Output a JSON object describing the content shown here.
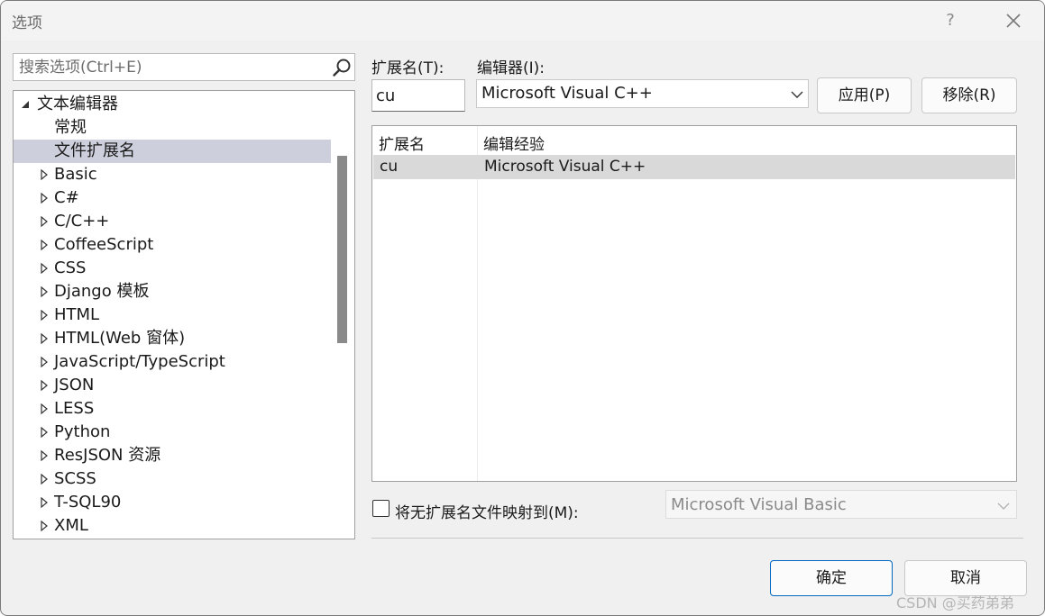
{
  "window": {
    "title": "选项",
    "help_label": "?"
  },
  "search": {
    "placeholder": "搜索选项(Ctrl+E)"
  },
  "tree": {
    "items": [
      {
        "label": "文本编辑器",
        "level": 0,
        "expanded": true,
        "selected": false
      },
      {
        "label": "常规",
        "level": 1,
        "selected": false
      },
      {
        "label": "文件扩展名",
        "level": 1,
        "selected": true
      },
      {
        "label": "Basic",
        "level": 1,
        "collapsed": true
      },
      {
        "label": "C#",
        "level": 1,
        "collapsed": true
      },
      {
        "label": "C/C++",
        "level": 1,
        "collapsed": true
      },
      {
        "label": "CoffeeScript",
        "level": 1,
        "collapsed": true
      },
      {
        "label": "CSS",
        "level": 1,
        "collapsed": true
      },
      {
        "label": "Django 模板",
        "level": 1,
        "collapsed": true
      },
      {
        "label": "HTML",
        "level": 1,
        "collapsed": true
      },
      {
        "label": "HTML(Web 窗体)",
        "level": 1,
        "collapsed": true
      },
      {
        "label": "JavaScript/TypeScript",
        "level": 1,
        "collapsed": true
      },
      {
        "label": "JSON",
        "level": 1,
        "collapsed": true
      },
      {
        "label": "LESS",
        "level": 1,
        "collapsed": true
      },
      {
        "label": "Python",
        "level": 1,
        "collapsed": true
      },
      {
        "label": "ResJSON 资源",
        "level": 1,
        "collapsed": true
      },
      {
        "label": "SCSS",
        "level": 1,
        "collapsed": true
      },
      {
        "label": "T-SQL90",
        "level": 1,
        "collapsed": true
      },
      {
        "label": "XML",
        "level": 1,
        "collapsed": true
      }
    ]
  },
  "extension": {
    "label": "扩展名(T):",
    "value": "cu"
  },
  "editor": {
    "label": "编辑器(I):",
    "value": "Microsoft Visual C++"
  },
  "buttons": {
    "apply": "应用(P)",
    "remove": "移除(R)",
    "ok": "确定",
    "cancel": "取消"
  },
  "mapping_list": {
    "columns": [
      "扩展名",
      "编辑经验"
    ],
    "rows": [
      {
        "extension": "cu",
        "editor": "Microsoft Visual C++"
      }
    ]
  },
  "map_extensionless": {
    "label": "将无扩展名文件映射到(M):",
    "checked": false,
    "value": "Microsoft Visual Basic"
  },
  "watermark": "CSDN @买药弟弟"
}
